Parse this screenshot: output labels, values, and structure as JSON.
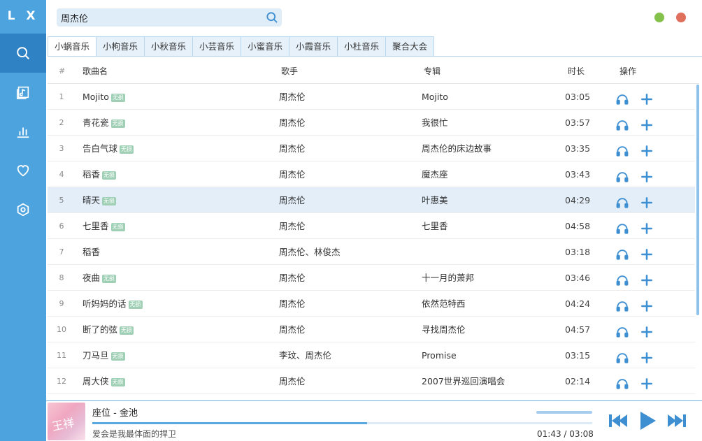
{
  "app": {
    "logo": "L X"
  },
  "sidebar": {
    "items": [
      {
        "name": "search-icon",
        "active": true
      },
      {
        "name": "music-note-icon",
        "active": false
      },
      {
        "name": "bar-chart-icon",
        "active": false
      },
      {
        "name": "heart-icon",
        "active": false
      },
      {
        "name": "gear-icon",
        "active": false
      }
    ]
  },
  "search": {
    "value": "周杰伦"
  },
  "colors": {
    "accent": "#4da3de",
    "accent_dark": "#2f82c4",
    "min": "#85c24c",
    "close": "#e06f5b",
    "badge": "#9fd0b6"
  },
  "tabs": [
    {
      "label": "小蜗音乐",
      "active": true
    },
    {
      "label": "小枸音乐"
    },
    {
      "label": "小秋音乐"
    },
    {
      "label": "小芸音乐"
    },
    {
      "label": "小蜜音乐"
    },
    {
      "label": "小霞音乐"
    },
    {
      "label": "小杜音乐"
    },
    {
      "label": "聚合大会"
    }
  ],
  "table": {
    "headers": {
      "num": "#",
      "name": "歌曲名",
      "singer": "歌手",
      "album": "专辑",
      "duration": "时长",
      "ops": "操作"
    },
    "badge_label": "无损",
    "rows": [
      {
        "num": "1",
        "name": "Mojito",
        "badge": true,
        "singer": "周杰伦",
        "album": "Mojito",
        "duration": "03:05"
      },
      {
        "num": "2",
        "name": "青花瓷",
        "badge": true,
        "singer": "周杰伦",
        "album": "我很忙",
        "duration": "03:57"
      },
      {
        "num": "3",
        "name": "告白气球",
        "badge": true,
        "singer": "周杰伦",
        "album": "周杰伦的床边故事",
        "duration": "03:35"
      },
      {
        "num": "4",
        "name": "稻香",
        "badge": true,
        "singer": "周杰伦",
        "album": "魔杰座",
        "duration": "03:43"
      },
      {
        "num": "5",
        "name": "晴天",
        "badge": true,
        "singer": "周杰伦",
        "album": "叶惠美",
        "duration": "04:29",
        "highlight": true
      },
      {
        "num": "6",
        "name": "七里香",
        "badge": true,
        "singer": "周杰伦",
        "album": "七里香",
        "duration": "04:58"
      },
      {
        "num": "7",
        "name": "稻香",
        "badge": false,
        "singer": "周杰伦、林俊杰",
        "album": "",
        "duration": "03:18"
      },
      {
        "num": "8",
        "name": "夜曲",
        "badge": true,
        "singer": "周杰伦",
        "album": "十一月的萧邦",
        "duration": "03:46"
      },
      {
        "num": "9",
        "name": "听妈妈的话",
        "badge": true,
        "singer": "周杰伦",
        "album": "依然范特西",
        "duration": "04:24"
      },
      {
        "num": "10",
        "name": "断了的弦",
        "badge": true,
        "singer": "周杰伦",
        "album": "寻找周杰伦",
        "duration": "04:57"
      },
      {
        "num": "11",
        "name": "刀马旦",
        "badge": true,
        "singer": "李玟、周杰伦",
        "album": "Promise",
        "duration": "03:15"
      },
      {
        "num": "12",
        "name": "周大侠",
        "badge": true,
        "singer": "周杰伦",
        "album": "2007世界巡回演唱会",
        "duration": "02:14"
      }
    ]
  },
  "player": {
    "title": "座位 - 金池",
    "lyric": "爱会是我最体面的捍卫",
    "current_time": "01:43",
    "separator": "/",
    "total_time": "03:08",
    "progress": 0.55,
    "cover_text": "王祥"
  }
}
